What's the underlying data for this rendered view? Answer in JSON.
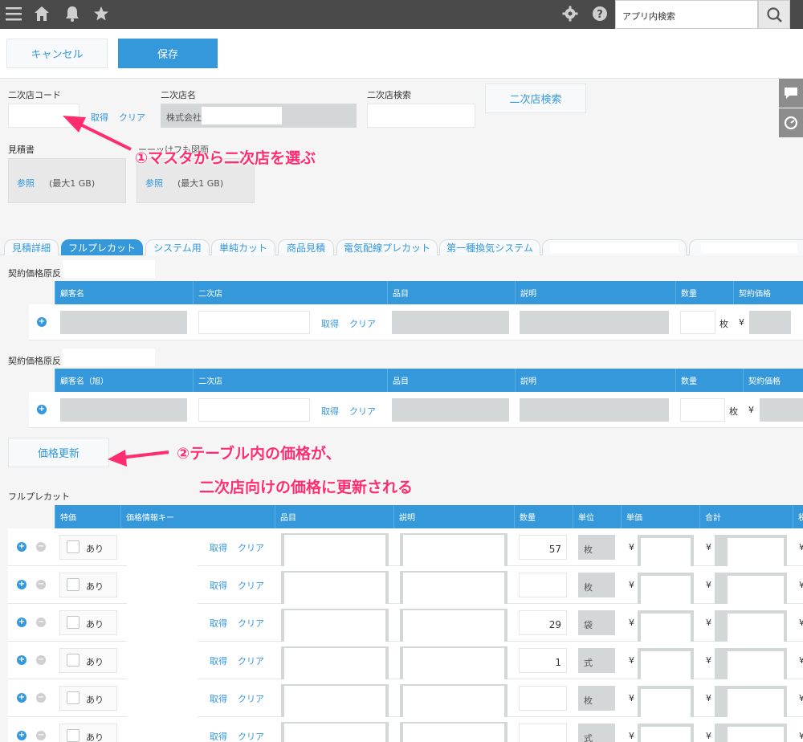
{
  "header": {
    "search_placeholder": "アプリ内検索",
    "icons": [
      "menu-icon",
      "home-icon",
      "bell-icon",
      "star-icon",
      "gear-icon",
      "help-icon",
      "search-icon"
    ]
  },
  "actions": {
    "cancel": "キャンセル",
    "save": "保存"
  },
  "form": {
    "secondary_code_label": "二次店コード",
    "secondary_name_label": "二次店名",
    "secondary_name_value": "株式会社",
    "secondary_search_label": "二次店検索",
    "secondary_search_button": "二次店検索",
    "fetch": "取得",
    "clear": "クリア",
    "estimate_label": "見積書",
    "second_file_label": "ーーッけフも図面",
    "browse": "参照",
    "max_size": "(最大1 GB)"
  },
  "tabs": [
    "見積詳細",
    "フルプレカット",
    "システム用",
    "単純カット",
    "商品見積",
    "電気配線プレカット",
    "第一種換気システム"
  ],
  "contract1": {
    "label": "契約価格原反",
    "columns": [
      "顧客名",
      "二次店",
      "品目",
      "説明",
      "数量",
      "契約価格"
    ],
    "unit": "枚",
    "yen": "¥"
  },
  "contract2": {
    "label": "契約価格原反",
    "columns": [
      "顧客名（旭）",
      "二次店",
      "品目",
      "説明",
      "数量",
      "契約価格"
    ],
    "unit": "枚",
    "yen": "¥"
  },
  "price_update_button": "価格更新",
  "fullprecut": {
    "label": "フルプレカット",
    "columns": [
      "特価",
      "価格情報キー",
      "品目",
      "説明",
      "数量",
      "単位",
      "単価",
      "合計",
      "税"
    ],
    "rows": [
      {
        "special": "あり",
        "qty": "57",
        "unit": "枚"
      },
      {
        "special": "あり",
        "qty": "",
        "unit": "枚"
      },
      {
        "special": "あり",
        "qty": "29",
        "unit": "袋"
      },
      {
        "special": "あり",
        "qty": "1",
        "unit": "式"
      },
      {
        "special": "あり",
        "qty": "",
        "unit": "枚"
      },
      {
        "special": "あり",
        "qty": "",
        "unit": "式"
      }
    ],
    "yen": "¥"
  },
  "annotations": {
    "step1": "①マスタから二次店を選ぶ",
    "step2_line1": "②テーブル内の価格が、",
    "step2_line2": "二次店向けの価格に更新される"
  },
  "colors": {
    "accent": "#3498db",
    "annotation": "#ff2d6f",
    "header": "#4a4a4a"
  }
}
